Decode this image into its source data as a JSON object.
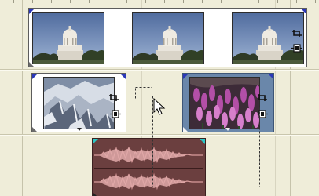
{
  "colors": {
    "track_background": "#efedd9",
    "clip_selected": "#6a87aa",
    "audio_clip": "#6b3f3f",
    "audio_wave": "#d99c9c",
    "marker_blue": "#2b38b8",
    "marker_cyan": "#2bc6c6"
  },
  "tracks": [
    {
      "type": "video",
      "clips": [
        {
          "content": "capitol-dome",
          "frames": 3,
          "selected": false
        }
      ]
    },
    {
      "type": "video",
      "clips": [
        {
          "content": "snowy-mountain",
          "frames": 1,
          "selected": false
        },
        {
          "content": "purple-wildflowers",
          "frames": 1,
          "selected": true
        }
      ]
    },
    {
      "type": "audio",
      "clips": [
        {
          "content": "waveform",
          "channels": 2
        }
      ]
    }
  ],
  "icons": [
    "crop-icon",
    "fit-frame-icon",
    "mouse-cursor-icon",
    "drag-outline"
  ]
}
